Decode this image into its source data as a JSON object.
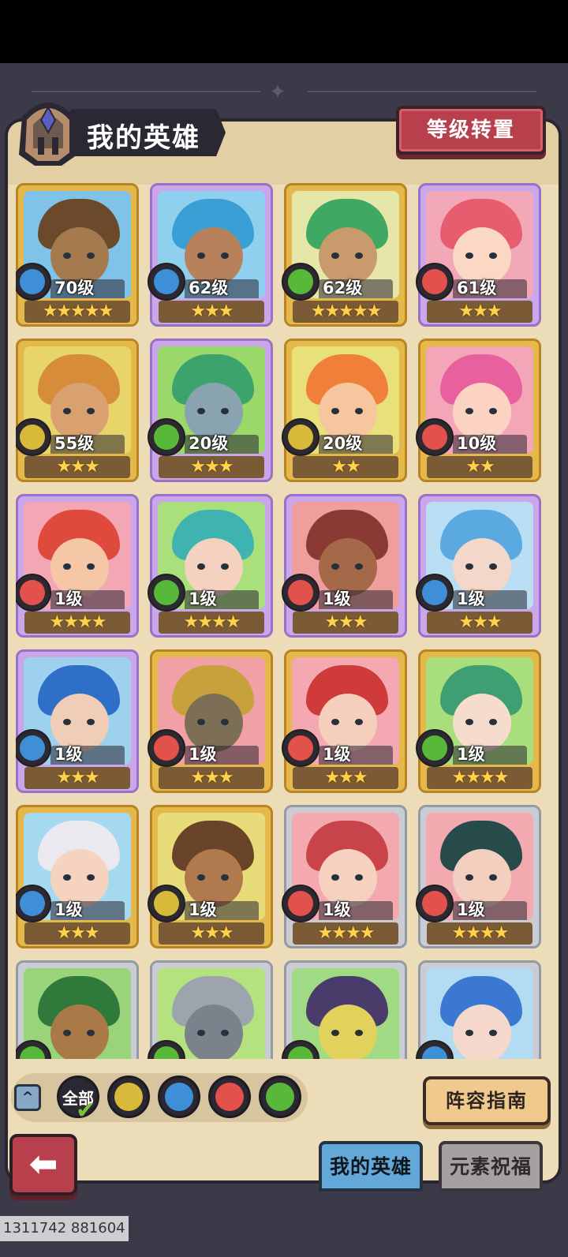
{
  "header": {
    "title": "我的英雄",
    "level_transfer_button": "等级转置"
  },
  "elements": {
    "water": "#3f8fd8",
    "fire": "#e2514b",
    "wood": "#58b83a",
    "earth": "#d9b93a"
  },
  "heroes": [
    {
      "level": "70级",
      "stars": "★★★★★",
      "element": "water",
      "frame": "gold",
      "bg": "#7fc3e8",
      "hair": "#6b4a2c",
      "skin": "#a57a4e"
    },
    {
      "level": "62级",
      "stars": "★★★",
      "element": "water",
      "frame": "purple",
      "bg": "#8fd0ef",
      "hair": "#3a9fd4",
      "skin": "#b7815c"
    },
    {
      "level": "62级",
      "stars": "★★★★★",
      "element": "wood",
      "frame": "gold",
      "bg": "#e6e6a8",
      "hair": "#3fa862",
      "skin": "#c99a6c"
    },
    {
      "level": "61级",
      "stars": "★★★",
      "element": "fire",
      "frame": "purple",
      "bg": "#f2a8b7",
      "hair": "#e65d6f",
      "skin": "#fbd8c4"
    },
    {
      "level": "55级",
      "stars": "★★★",
      "element": "earth",
      "frame": "gold",
      "bg": "#e8d56a",
      "hair": "#d78c3a",
      "skin": "#d9a070"
    },
    {
      "level": "20级",
      "stars": "★★★",
      "element": "wood",
      "frame": "purple",
      "bg": "#9bd86a",
      "hair": "#3da36d",
      "skin": "#8aa3b0"
    },
    {
      "level": "20级",
      "stars": "★★",
      "element": "earth",
      "frame": "gold",
      "bg": "#e9e07a",
      "hair": "#f07f3a",
      "skin": "#f6c79e"
    },
    {
      "level": "10级",
      "stars": "★★",
      "element": "fire",
      "frame": "gold",
      "bg": "#f3a6b8",
      "hair": "#e8609e",
      "skin": "#fcd3c3"
    },
    {
      "level": "1级",
      "stars": "★★★★",
      "element": "fire",
      "frame": "purple",
      "bg": "#f3a6b4",
      "hair": "#e04a3c",
      "skin": "#f5c7a7"
    },
    {
      "level": "1级",
      "stars": "★★★★",
      "element": "wood",
      "frame": "purple",
      "bg": "#a9e07b",
      "hair": "#3fb3b0",
      "skin": "#f5d1bf"
    },
    {
      "level": "1级",
      "stars": "★★★",
      "element": "fire",
      "frame": "purple",
      "bg": "#ef9d9d",
      "hair": "#8a3a32",
      "skin": "#a5694a"
    },
    {
      "level": "1级",
      "stars": "★★★",
      "element": "water",
      "frame": "purple",
      "bg": "#b9ddf2",
      "hair": "#5aa9e0",
      "skin": "#f3d7c9"
    },
    {
      "level": "1级",
      "stars": "★★★",
      "element": "water",
      "frame": "purple",
      "bg": "#9dd1ee",
      "hair": "#2f6fc7",
      "skin": "#f0cdb6"
    },
    {
      "level": "1级",
      "stars": "★★★",
      "element": "fire",
      "frame": "gold",
      "bg": "#f1a0a5",
      "hair": "#c7a13c",
      "skin": "#7d6f56"
    },
    {
      "level": "1级",
      "stars": "★★★",
      "element": "fire",
      "frame": "gold",
      "bg": "#f4a9b2",
      "hair": "#cf3a3a",
      "skin": "#f6cfbc"
    },
    {
      "level": "1级",
      "stars": "★★★★",
      "element": "wood",
      "frame": "gold",
      "bg": "#a8df7c",
      "hair": "#3e9f72",
      "skin": "#f6dccd"
    },
    {
      "level": "1级",
      "stars": "★★★",
      "element": "water",
      "frame": "gold",
      "bg": "#a5d9f0",
      "hair": "#e9e9ef",
      "skin": "#f5d3bf"
    },
    {
      "level": "1级",
      "stars": "★★★",
      "element": "earth",
      "frame": "gold",
      "bg": "#e8dc7a",
      "hair": "#6a4428",
      "skin": "#b17a4e"
    },
    {
      "level": "1级",
      "stars": "★★★★",
      "element": "fire",
      "frame": "silver",
      "bg": "#f3a9ad",
      "hair": "#c8444a",
      "skin": "#f6d1c0"
    },
    {
      "level": "1级",
      "stars": "★★★★",
      "element": "fire",
      "frame": "silver",
      "bg": "#f2aab0",
      "hair": "#274a4b",
      "skin": "#f3cfbf"
    },
    {
      "level": "",
      "stars": "",
      "element": "wood",
      "frame": "silver",
      "bg": "#9ad47a",
      "hair": "#2f7a3a",
      "skin": "#a97a48"
    },
    {
      "level": "",
      "stars": "",
      "element": "wood",
      "frame": "silver",
      "bg": "#b4e27e",
      "hair": "#9ea4ad",
      "skin": "#7b828c"
    },
    {
      "level": "",
      "stars": "",
      "element": "wood",
      "frame": "silver",
      "bg": "#a0da84",
      "hair": "#4a3c6a",
      "skin": "#e2d15a"
    },
    {
      "level": "",
      "stars": "",
      "element": "water",
      "frame": "silver",
      "bg": "#b3dcf3",
      "hair": "#3a78d2",
      "skin": "#f5d8cb"
    }
  ],
  "filter": {
    "collapse_icon": "^",
    "all_label": "全部",
    "options": [
      "earth",
      "water",
      "fire",
      "wood"
    ]
  },
  "guide_button": "阵容指南",
  "tabs": {
    "active": "我的英雄",
    "inactive": "元素祝福"
  },
  "watermark": "1311742 881604"
}
